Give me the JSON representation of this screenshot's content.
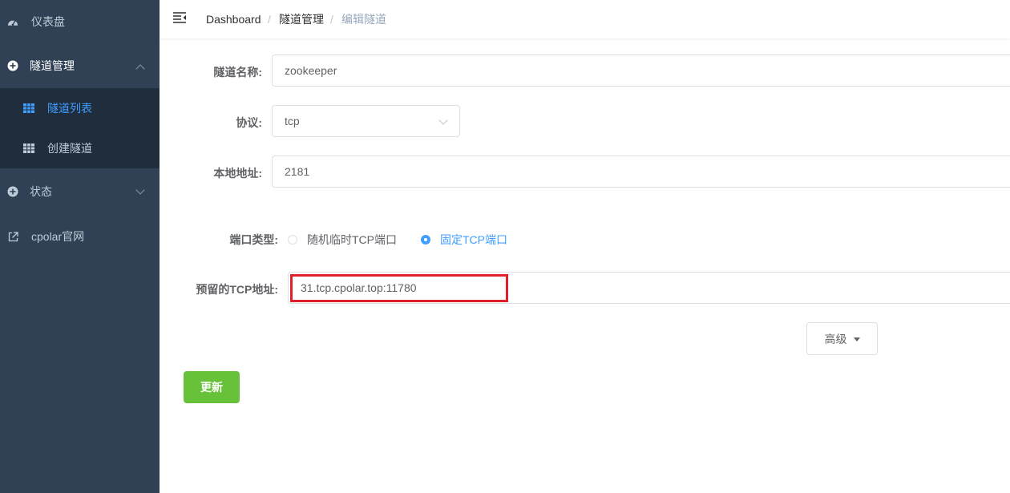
{
  "sidebar": {
    "items": [
      {
        "label": "仪表盘",
        "icon": "dashboard-icon"
      },
      {
        "label": "隧道管理",
        "icon": "tunnel-icon"
      },
      {
        "label": "隧道列表",
        "icon": "table-icon"
      },
      {
        "label": "创建隧道",
        "icon": "table-icon"
      },
      {
        "label": "状态",
        "icon": "status-icon"
      },
      {
        "label": "cpolar官网",
        "icon": "external-link-icon"
      }
    ]
  },
  "breadcrumb": {
    "items": [
      "Dashboard",
      "隧道管理",
      "编辑隧道"
    ],
    "separator": "/"
  },
  "form": {
    "name_label": "隧道名称:",
    "name_value": "zookeeper",
    "protocol_label": "协议:",
    "protocol_value": "tcp",
    "local_label": "本地地址:",
    "local_value": "2181",
    "port_type_label": "端口类型:",
    "port_type_options": [
      "随机临时TCP端口",
      "固定TCP端口"
    ],
    "port_type_selected": "固定TCP端口",
    "reserved_label": "预留的TCP地址:",
    "reserved_value": "31.tcp.cpolar.top:11780",
    "advanced_label": "高级",
    "update_label": "更新"
  },
  "colors": {
    "sidebar_bg": "#304156",
    "submenu_bg": "#1f2d3d",
    "active": "#409eff",
    "update_button": "#67c23a",
    "highlight_box": "#e0202a"
  }
}
